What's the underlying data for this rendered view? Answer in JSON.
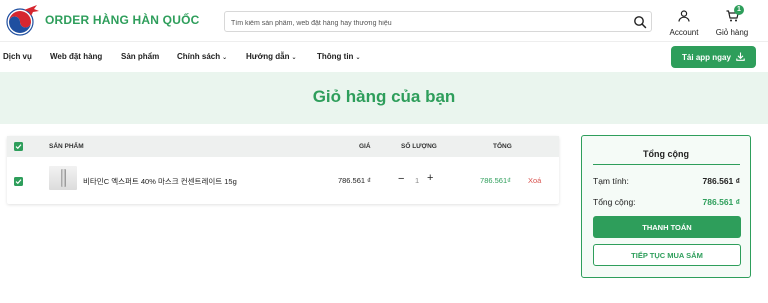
{
  "brand": {
    "name": "ORDER HÀNG HÀN QUỐC",
    "accent": "#2e9e5b"
  },
  "search": {
    "placeholder": "Tìm kiếm sản phẩm, web đặt hàng hay thương hiệu"
  },
  "header": {
    "account_label": "Account",
    "cart_label": "Giỏ hàng",
    "cart_count": "1"
  },
  "nav": {
    "items": [
      {
        "label": "Dịch vụ"
      },
      {
        "label": "Web đặt hàng"
      },
      {
        "label": "Sản phẩm"
      },
      {
        "label": "Chính sách",
        "chevron": "⌄"
      },
      {
        "label": "Hướng dẫn",
        "chevron": "⌄"
      },
      {
        "label": "Thông tin",
        "chevron": "⌄"
      }
    ],
    "app_button": "Tải app ngay"
  },
  "page": {
    "title": "Giỏ hàng của bạn"
  },
  "table": {
    "headers": {
      "product": "Sản phẩm",
      "price": "Giá",
      "qty": "Số lượng",
      "total": "Tổng"
    },
    "rows": [
      {
        "name": "비타민C 엑스퍼트 40% 마스크 컨센트레이트 15g",
        "price": "786.561 ₫",
        "qty": "1",
        "total": "786.561₫",
        "delete": "Xoá"
      }
    ]
  },
  "summary": {
    "title": "Tổng cộng",
    "subtotal_label": "Tạm tính:",
    "subtotal_value": "786.561 ₫",
    "total_label": "Tổng cộng:",
    "total_value": "786.561 ₫",
    "pay_button": "Thanh toán",
    "continue_button": "Tiếp tục mua sắm"
  }
}
